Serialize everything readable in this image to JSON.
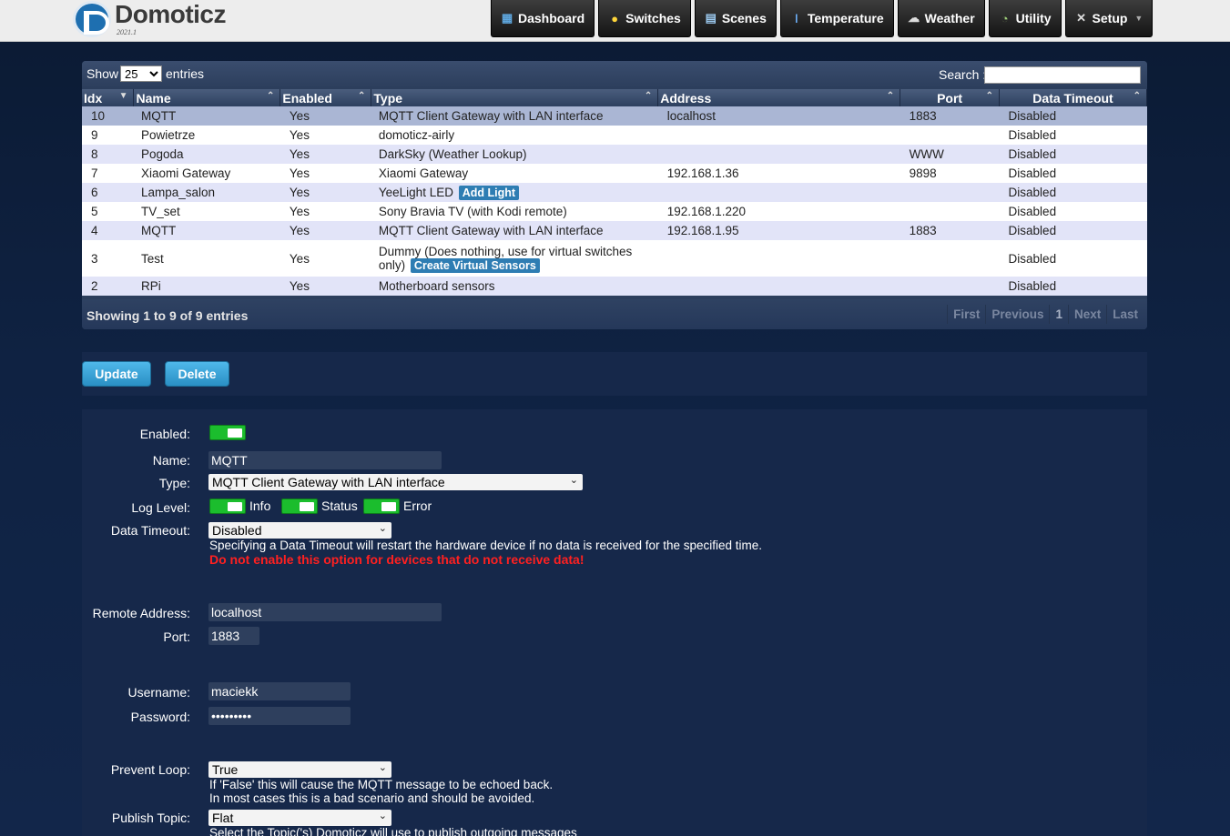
{
  "brand": {
    "name": "Domoticz",
    "version": "2021.1"
  },
  "nav": [
    {
      "label": "Dashboard",
      "icon": "dashboard-icon"
    },
    {
      "label": "Switches",
      "icon": "lightbulb-icon"
    },
    {
      "label": "Scenes",
      "icon": "scenes-icon"
    },
    {
      "label": "Temperature",
      "icon": "thermometer-icon"
    },
    {
      "label": "Weather",
      "icon": "cloud-icon"
    },
    {
      "label": "Utility",
      "icon": "utility-icon"
    },
    {
      "label": "Setup",
      "icon": "tools-icon"
    }
  ],
  "table": {
    "show_label": "Show",
    "entries_value": "25",
    "entries_label": "entries",
    "search_label": "Search :",
    "columns": [
      "Idx",
      "Name",
      "Enabled",
      "Type",
      "Address",
      "Port",
      "Data Timeout"
    ],
    "rows": [
      {
        "idx": "10",
        "name": "MQTT",
        "enabled": "Yes",
        "type": "MQTT Client Gateway with LAN interface",
        "type_button": "",
        "address": "localhost",
        "port": "1883",
        "timeout": "Disabled"
      },
      {
        "idx": "9",
        "name": "Powietrze",
        "enabled": "Yes",
        "type": "domoticz-airly",
        "type_button": "",
        "address": "",
        "port": "",
        "timeout": "Disabled"
      },
      {
        "idx": "8",
        "name": "Pogoda",
        "enabled": "Yes",
        "type": "DarkSky (Weather Lookup)",
        "type_button": "",
        "address": "",
        "port": "WWW",
        "timeout": "Disabled"
      },
      {
        "idx": "7",
        "name": "Xiaomi Gateway",
        "enabled": "Yes",
        "type": "Xiaomi Gateway",
        "type_button": "",
        "address": "192.168.1.36",
        "port": "9898",
        "timeout": "Disabled"
      },
      {
        "idx": "6",
        "name": "Lampa_salon",
        "enabled": "Yes",
        "type": "YeeLight LED",
        "type_button": "Add Light",
        "address": "",
        "port": "",
        "timeout": "Disabled"
      },
      {
        "idx": "5",
        "name": "TV_set",
        "enabled": "Yes",
        "type": "Sony Bravia TV (with Kodi remote)",
        "type_button": "",
        "address": "192.168.1.220",
        "port": "",
        "timeout": "Disabled"
      },
      {
        "idx": "4",
        "name": "MQTT",
        "enabled": "Yes",
        "type": "MQTT Client Gateway with LAN interface",
        "type_button": "",
        "address": "192.168.1.95",
        "port": "1883",
        "timeout": "Disabled"
      },
      {
        "idx": "3",
        "name": "Test",
        "enabled": "Yes",
        "type": "Dummy (Does nothing, use for virtual switches only)",
        "type_button": "Create Virtual Sensors",
        "address": "",
        "port": "",
        "timeout": "Disabled"
      },
      {
        "idx": "2",
        "name": "RPi",
        "enabled": "Yes",
        "type": "Motherboard sensors",
        "type_button": "",
        "address": "",
        "port": "",
        "timeout": "Disabled"
      }
    ],
    "showing": "Showing 1 to 9 of 9 entries",
    "pager": [
      "First",
      "Previous",
      "1",
      "Next",
      "Last"
    ]
  },
  "actions": {
    "update": "Update",
    "delete": "Delete"
  },
  "form": {
    "enabled_label": "Enabled:",
    "name_label": "Name:",
    "name_value": "MQTT",
    "type_label": "Type:",
    "type_value": "MQTT Client Gateway with LAN interface",
    "loglevel_label": "Log Level:",
    "log_info": "Info",
    "log_status": "Status",
    "log_error": "Error",
    "timeout_label": "Data Timeout:",
    "timeout_value": "Disabled",
    "timeout_help": "Specifying a Data Timeout will restart the hardware device if no data is received for the specified time.",
    "timeout_warning": "Do not enable this option for devices that do not receive data!",
    "remote_label": "Remote Address:",
    "remote_value": "localhost",
    "port_label": "Port:",
    "port_value": "1883",
    "username_label": "Username:",
    "username_value": "maciekk",
    "password_label": "Password:",
    "password_value": "•••••••••",
    "loop_label": "Prevent Loop:",
    "loop_value": "True",
    "loop_help1": "If 'False' this will cause the MQTT message to be echoed back.",
    "loop_help2": "In most cases this is a bad scenario and should be avoided.",
    "topic_label": "Publish Topic:",
    "topic_value": "Flat",
    "topic_help": "Select the Topic('s) Domoticz will use to publish outgoing messages"
  }
}
